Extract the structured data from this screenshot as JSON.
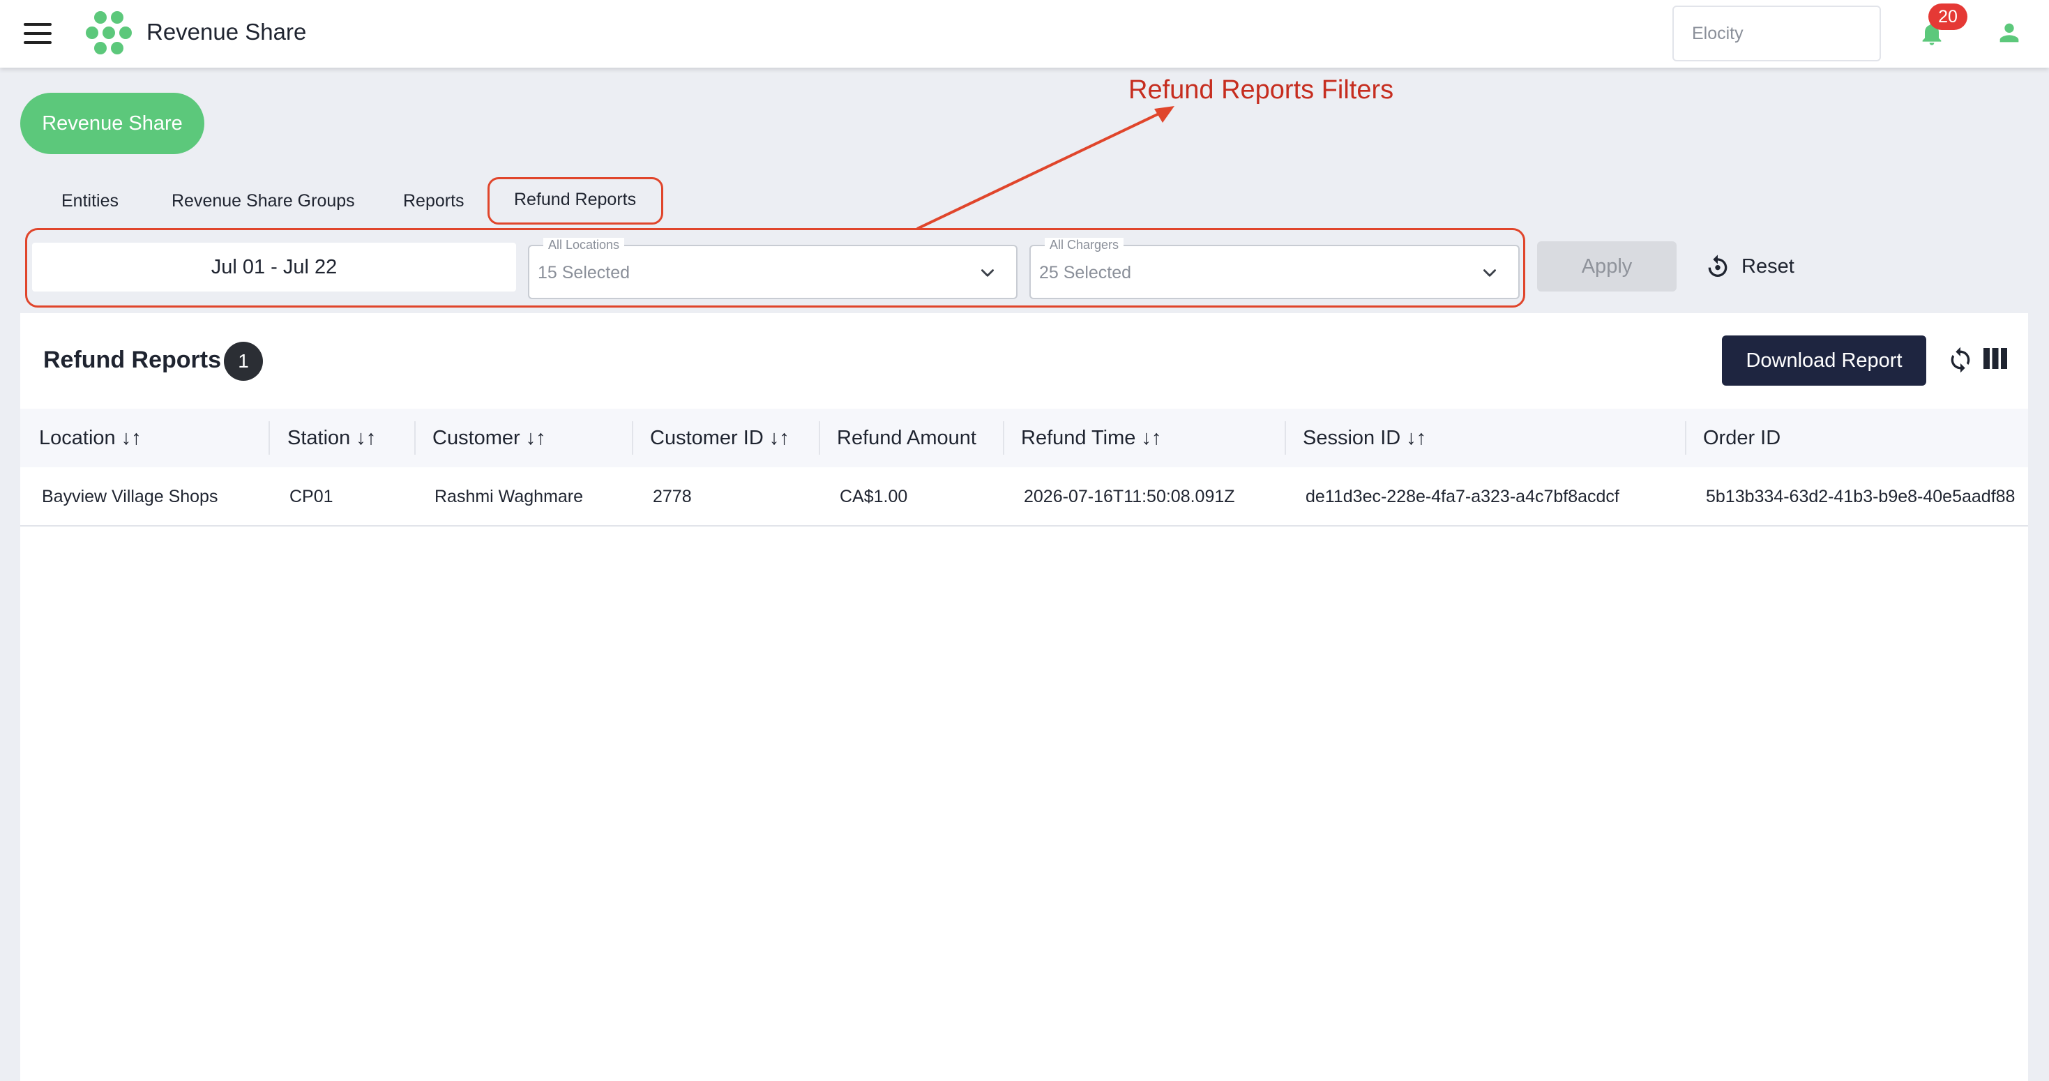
{
  "header": {
    "title": "Revenue Share",
    "org_placeholder": "Elocity",
    "notification_count": "20",
    "brand_color": "#5cc87b"
  },
  "page": {
    "pill_label": "Revenue Share"
  },
  "tabs": [
    {
      "label": "Entities"
    },
    {
      "label": "Revenue Share Groups"
    },
    {
      "label": "Reports"
    },
    {
      "label": "Refund Reports",
      "active": true
    }
  ],
  "filters": {
    "date_range": "Jul 01 - Jul 22",
    "locations": {
      "legend": "All Locations",
      "value": "15 Selected"
    },
    "chargers": {
      "legend": "All Chargers",
      "value": "25 Selected"
    },
    "apply_label": "Apply",
    "reset_label": "Reset"
  },
  "annotation": {
    "text": "Refund Reports Filters",
    "color": "#c62d1f"
  },
  "report": {
    "title": "Refund Reports",
    "count": "1",
    "download_label": "Download Report",
    "columns": [
      {
        "label": "Location",
        "sortable": true
      },
      {
        "label": "Station",
        "sortable": true
      },
      {
        "label": "Customer",
        "sortable": true
      },
      {
        "label": "Customer ID",
        "sortable": true
      },
      {
        "label": "Refund Amount",
        "sortable": false
      },
      {
        "label": "Refund Time",
        "sortable": true
      },
      {
        "label": "Session ID",
        "sortable": true
      },
      {
        "label": "Order ID",
        "sortable": false
      }
    ],
    "sort_glyph": "↓↑",
    "rows": [
      {
        "location": "Bayview Village Shops",
        "station": "CP01",
        "customer": "Rashmi Waghmare",
        "customer_id": "2778",
        "refund_amount": "CA$1.00",
        "refund_time": "2026-07-16T11:50:08.091Z",
        "session_id": "de11d3ec-228e-4fa7-a323-a4c7bf8acdcf",
        "order_id": "5b13b334-63d2-41b3-b9e8-40e5aadf88"
      }
    ]
  }
}
